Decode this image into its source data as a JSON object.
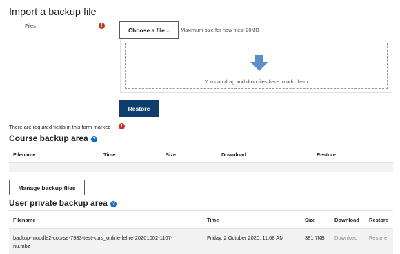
{
  "import_section": {
    "title": "Import a backup file",
    "files_label": "Files",
    "choose_button": "Choose a file...",
    "max_size_text": "Maximum size for new files: 20MB",
    "drop_text": "You can drag and drop files here to add them.",
    "restore_button": "Restore",
    "required_note": "There are required fields in this form marked"
  },
  "course_backup": {
    "title": "Course backup area",
    "headers": [
      "Filename",
      "Time",
      "Size",
      "Download",
      "Restore"
    ],
    "manage_button": "Manage backup files"
  },
  "user_backup": {
    "title": "User private backup area",
    "headers": [
      "Filename",
      "Time",
      "Size",
      "Download",
      "Restore"
    ],
    "rows": [
      {
        "filename_line1": "backup-moodle2-course-7983-test-kurs_online-lehre-20201002-1107-",
        "filename_line2": "nu.mbz",
        "time": "Friday, 2 October 2020, 11:08 AM",
        "size": "381.7KB",
        "download": "Download",
        "restore": "Restore"
      }
    ]
  },
  "colors": {
    "primary": "#0f3e6e",
    "required": "#ca3120",
    "help": "#0f6cbf",
    "arrow": "#5b8fc9"
  }
}
